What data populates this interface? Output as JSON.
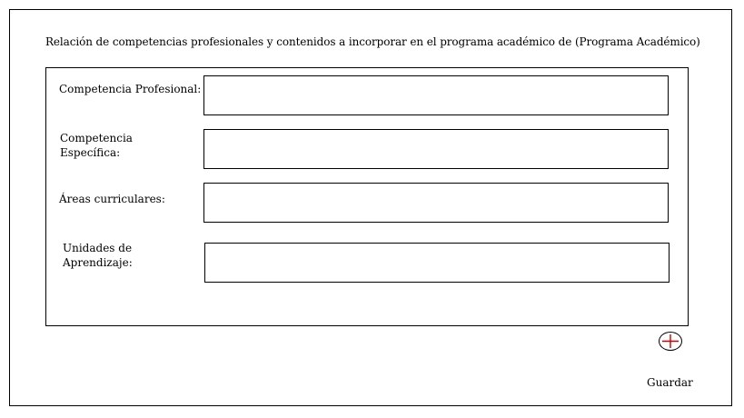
{
  "page": {
    "title": "Relación de competencias profesionales y contenidos a incorporar en el programa académico de (Programa Académico)"
  },
  "form": {
    "fields": [
      {
        "label_lines": [
          "Competencia Profesional:"
        ],
        "value": ""
      },
      {
        "label_lines": [
          "Competencia",
          "Específica:"
        ],
        "value": ""
      },
      {
        "label_lines": [
          "Áreas curriculares:"
        ],
        "value": ""
      },
      {
        "label_lines": [
          "Unidades de",
          "Aprendizaje:"
        ],
        "value": ""
      }
    ]
  },
  "actions": {
    "add_icon": "plus-circle-icon",
    "add_icon_color": "#cc0000",
    "save_label": "Guardar"
  }
}
